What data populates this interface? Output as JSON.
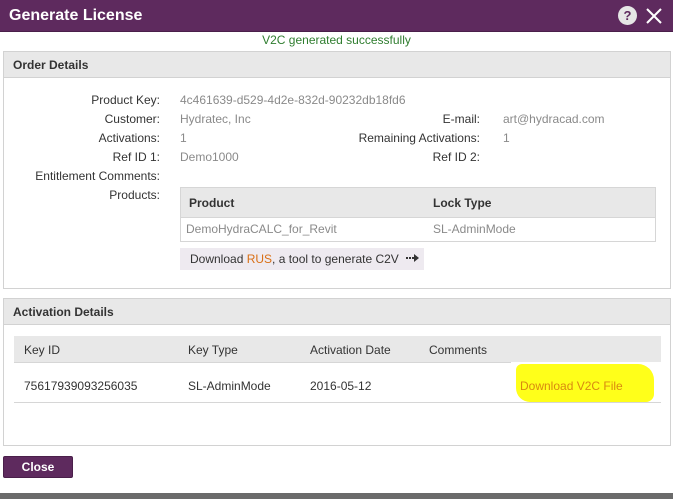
{
  "dialog": {
    "title": "Generate License",
    "help_label": "?",
    "success_message": "V2C generated successfully",
    "colors": {
      "titlebar": "#5e2a5e",
      "success": "#2f7d2f",
      "link": "#d96f15",
      "highlight": "#ffff1a"
    }
  },
  "order": {
    "heading": "Order Details",
    "product_key_label": "Product Key:",
    "product_key": "4c461639-d529-4d2e-832d-90232db18fd6",
    "customer_label": "Customer:",
    "customer": "Hydratec, Inc",
    "email_label": "E-mail:",
    "email": "art@hydracad.com",
    "activations_label": "Activations:",
    "activations": "1",
    "remaining_label": "Remaining Activations:",
    "remaining": "1",
    "ref1_label": "Ref ID 1:",
    "ref1": "Demo1000",
    "ref2_label": "Ref ID 2:",
    "entitlement_label": "Entitlement Comments:",
    "products_label": "Products:",
    "products_table": {
      "headers": [
        "Product",
        "Lock Type"
      ],
      "rows": [
        [
          "DemoHydraCALC_for_Revit",
          "SL-AdminMode"
        ]
      ]
    },
    "rus": {
      "prefix": "Download ",
      "link": "RUS",
      "suffix": ", a tool to generate C2V"
    }
  },
  "activation": {
    "heading": "Activation Details",
    "headers": [
      "Key ID",
      "Key Type",
      "Activation Date",
      "Comments"
    ],
    "rows": [
      {
        "key_id": "75617939093256035",
        "key_type": "SL-AdminMode",
        "date": "2016-05-12",
        "comments": ""
      }
    ],
    "download_label": "Download V2C File"
  },
  "footer": {
    "close_label": "Close"
  }
}
